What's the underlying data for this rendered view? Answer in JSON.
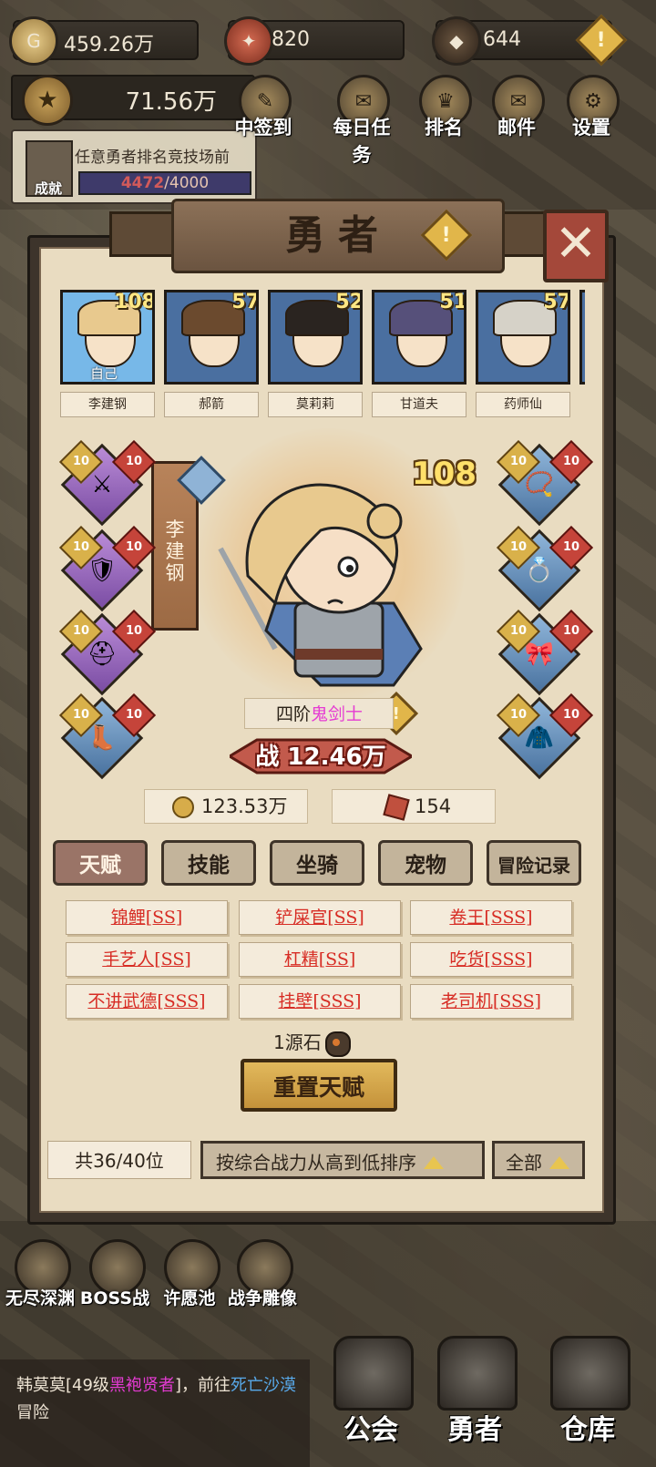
{
  "resources": {
    "gold": "459.26万",
    "tickets": "820",
    "stones": "644"
  },
  "power": "71.56万",
  "quest": {
    "text": "任意勇者排名竞技场前",
    "progress_current": "4472",
    "progress_sep": "/4000",
    "label": "成就"
  },
  "top_buttons": [
    "中签到",
    "每日任务",
    "排名",
    "邮件",
    "设置"
  ],
  "panel": {
    "title": "勇者",
    "close_label": "✕"
  },
  "heroes": [
    {
      "name": "李建钢",
      "level": "108",
      "self_label": "自己",
      "hair": "#e8c98e"
    },
    {
      "name": "郝箭",
      "level": "57",
      "self_label": "",
      "hair": "#6b4a2e"
    },
    {
      "name": "莫莉莉",
      "level": "52",
      "self_label": "",
      "hair": "#2a2420"
    },
    {
      "name": "甘道夫",
      "level": "51",
      "self_label": "",
      "hair": "#56507a"
    },
    {
      "name": "药师仙",
      "level": "57",
      "self_label": "",
      "hair": "#d6d2c8"
    }
  ],
  "equipment_left": [
    {
      "icon": "spear-icon",
      "glyph": "⚔",
      "level": "10",
      "rank": "10",
      "color": "purple"
    },
    {
      "icon": "armor-icon",
      "glyph": "🛡",
      "level": "10",
      "rank": "10",
      "color": "purple"
    },
    {
      "icon": "helmet-icon",
      "glyph": "⛑",
      "level": "10",
      "rank": "10",
      "color": "purple"
    },
    {
      "icon": "boots-icon",
      "glyph": "👢",
      "level": "10",
      "rank": "10",
      "color": "blue"
    }
  ],
  "equipment_right": [
    {
      "icon": "necklace-icon",
      "glyph": "📿",
      "level": "10",
      "rank": "10",
      "color": "blue"
    },
    {
      "icon": "ring-icon",
      "glyph": "💍",
      "level": "10",
      "rank": "10",
      "color": "blue"
    },
    {
      "icon": "belt-icon",
      "glyph": "🎀",
      "level": "10",
      "rank": "10",
      "color": "blue"
    },
    {
      "icon": "cloak-icon",
      "glyph": "🧥",
      "level": "10",
      "rank": "10",
      "color": "blue"
    }
  ],
  "current_hero": {
    "name": "李建钢",
    "level": "108",
    "class_prefix": "四阶",
    "class_name": "鬼剑士",
    "battle_label": "战",
    "battle_power": "12.46万",
    "gold_cost": "123.53万",
    "ticket_cost": "154"
  },
  "tabs": [
    "天赋",
    "技能",
    "坐骑",
    "宠物",
    "冒险记录"
  ],
  "talents": [
    "锦鲤[SS]",
    "铲屎官[SS]",
    "卷王[SSS]",
    "手艺人[SS]",
    "杠精[SS]",
    "吃货[SSS]",
    "不讲武德[SSS]",
    "挂壁[SSS]",
    "老司机[SSS]"
  ],
  "reset": {
    "cost_text": "1源石",
    "button_label": "重置天赋"
  },
  "footer": {
    "count": "共36/40位",
    "sort_label": "按综合战力从高到低排序",
    "filter_label": "全部"
  },
  "modes": [
    "无尽深渊",
    "BOSS战",
    "许愿池",
    "战争雕像"
  ],
  "chat": {
    "name": "韩莫莫[49级",
    "role": "黑袍贤者",
    "mid": "]，前往",
    "place": "死亡沙漠",
    "tail": "冒险"
  },
  "nav": [
    "公会",
    "勇者",
    "仓库"
  ],
  "colors": {
    "panel_bg": "#e9dcc1",
    "talent_text": "#d72c24",
    "class_pink": "#e53bd3",
    "accent_gold": "#e1b64a"
  }
}
